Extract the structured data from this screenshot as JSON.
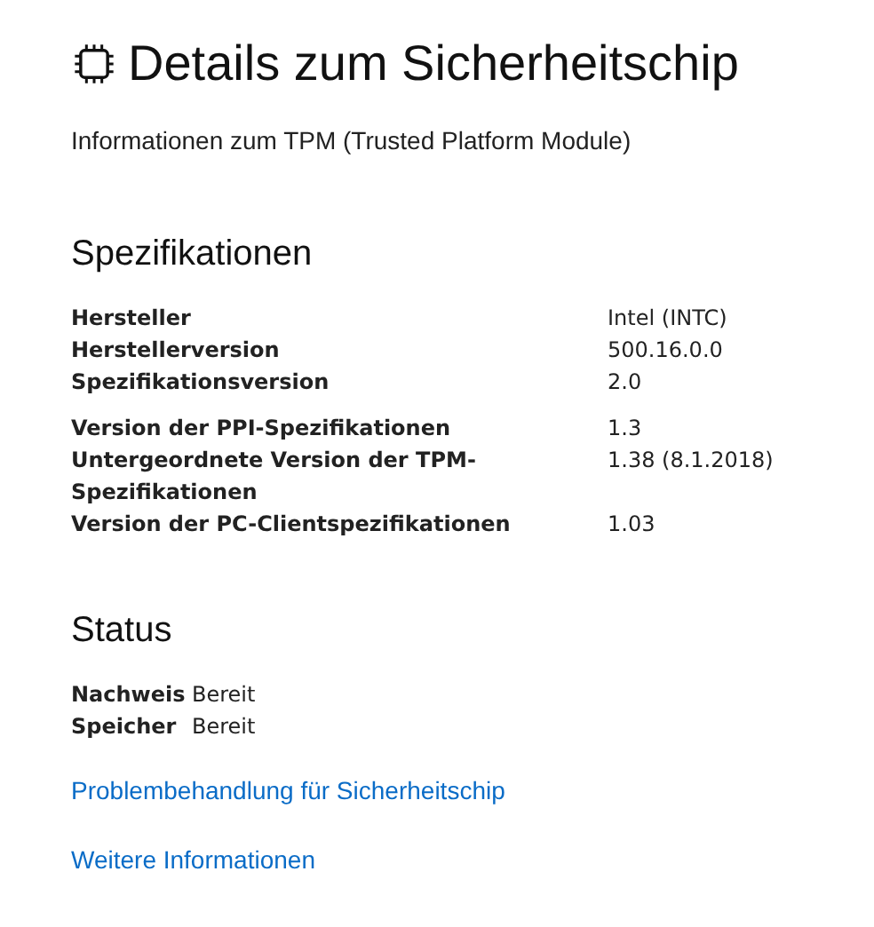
{
  "header": {
    "title": "Details zum Sicherheitschip",
    "subtitle": "Informationen zum TPM (Trusted Platform Module)"
  },
  "specifications": {
    "heading": "Spezifikationen",
    "groups": [
      [
        {
          "label": "Hersteller",
          "value": "Intel (INTC)"
        },
        {
          "label": "Herstellerversion",
          "value": "500.16.0.0"
        },
        {
          "label": "Spezifikationsversion",
          "value": "2.0"
        }
      ],
      [
        {
          "label": "Version der PPI-Spezifikationen",
          "value": "1.3"
        },
        {
          "label": "Untergeordnete Version der TPM-Spezifikationen",
          "value": "1.38 (8.1.2018)"
        },
        {
          "label": "Version der PC-Clientspezifikationen",
          "value": "1.03"
        }
      ]
    ]
  },
  "status": {
    "heading": "Status",
    "rows": [
      {
        "label": "Nachweis",
        "value": "Bereit"
      },
      {
        "label": "Speicher",
        "value": "Bereit"
      }
    ]
  },
  "links": [
    "Problembehandlung für Sicherheitschip",
    "Weitere Informationen"
  ]
}
